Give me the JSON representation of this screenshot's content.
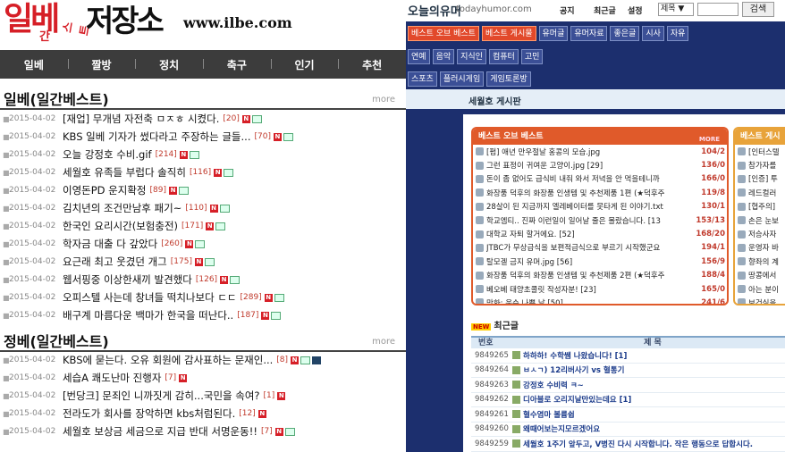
{
  "left": {
    "logo_big": "일베",
    "logo_small": "간",
    "logo_mid": "스트",
    "logo_big2": "저장소",
    "logo_url": "www.ilbe.com",
    "nav": [
      "일베",
      "짤방",
      "정치",
      "축구",
      "인기",
      "추천"
    ],
    "ilbe": {
      "title": "일베(일간베스트)",
      "more": "more",
      "items": [
        {
          "date": "2015-04-02",
          "title": "[재업] 무개념 자전축 ㅁㅈㅎ 시켰다.",
          "count": "[20]",
          "media": [
            "N",
            "img"
          ]
        },
        {
          "date": "2015-04-02",
          "title": "KBS 일베 기자가 썼다라고 주장하는 글들...",
          "count": "[70]",
          "media": [
            "N",
            "img"
          ]
        },
        {
          "date": "2015-04-02",
          "title": "오늘 강정호 수비.gif",
          "count": "[214]",
          "media": [
            "N",
            "img"
          ]
        },
        {
          "date": "2015-04-02",
          "title": "세월호 유족들 부럽다 솔직히",
          "count": "[116]",
          "media": [
            "N",
            "img"
          ]
        },
        {
          "date": "2015-04-02",
          "title": "이영돈PD 운지확정",
          "count": "[89]",
          "media": [
            "N",
            "img"
          ]
        },
        {
          "date": "2015-04-02",
          "title": "김치년의 조건만남후 패기~",
          "count": "[110]",
          "media": [
            "N",
            "img"
          ]
        },
        {
          "date": "2015-04-02",
          "title": "한국인 요리시간(보험충전)",
          "count": "[171]",
          "media": [
            "N",
            "img"
          ]
        },
        {
          "date": "2015-04-02",
          "title": "학자금 대출 다 갚았다",
          "count": "[260]",
          "media": [
            "N",
            "img"
          ]
        },
        {
          "date": "2015-04-02",
          "title": "요근래 최고 웃겼던 개그",
          "count": "[175]",
          "media": [
            "N",
            "img"
          ]
        },
        {
          "date": "2015-04-02",
          "title": "웹서핑중 이상한새끼 발견했다",
          "count": "[126]",
          "media": [
            "N",
            "img"
          ]
        },
        {
          "date": "2015-04-02",
          "title": "오피스텔 사는데 창녀들 떡치나보다 ㄷㄷ",
          "count": "[289]",
          "media": [
            "N",
            "img"
          ]
        },
        {
          "date": "2015-04-02",
          "title": "배구계 마름다운 백마가 한국을 떠난다..",
          "count": "[187]",
          "media": [
            "N",
            "img"
          ]
        }
      ]
    },
    "jungbe": {
      "title": "정베(일간베스트)",
      "more": "more",
      "items": [
        {
          "date": "2015-04-02",
          "title": "KBS에 묻는다. 오유 회원에 감사표하는 문재인...",
          "count": "[8]",
          "media": [
            "N",
            "img",
            "vid"
          ]
        },
        {
          "date": "2015-04-02",
          "title": "세습A 쾌도난마 진행자",
          "count": "[7]",
          "media": [
            "N"
          ]
        },
        {
          "date": "2015-04-02",
          "title": "[번당크] 문죄인 니까짓게 감히...국민을 속여?",
          "count": "[1]",
          "media": [
            "N"
          ]
        },
        {
          "date": "2015-04-02",
          "title": "전라도가 회사를 장악하면 kbs처럼된다.",
          "count": "[12]",
          "media": [
            "N"
          ]
        },
        {
          "date": "2015-04-02",
          "title": "세월호 보상금 세금으로 지급 반대 서명운동!!",
          "count": "[7]",
          "media": [
            "N",
            "img"
          ]
        }
      ]
    }
  },
  "right": {
    "logo": "오늘의유머",
    "logo_sub": "todayhumor.com",
    "top_links": [
      "공지",
      "최근글",
      "설정"
    ],
    "search_select": "제목 ▼",
    "search_button": "검색",
    "tabs_row1": [
      "베스트 오브 베스트",
      "베스트 게시물",
      "유머글",
      "유머자료",
      "좋은글",
      "시사",
      "자유"
    ],
    "tabs_row2": [
      "연예",
      "음악",
      "지식인",
      "컴퓨터",
      "고민"
    ],
    "tabs_row3": [
      "스포츠",
      "플러시게임",
      "게임토론방"
    ],
    "board_title": "세월호 게시판",
    "bob_header": "베스트 오브 베스트",
    "bob_more": "MORE",
    "bob_items": [
      {
        "title": "[펌] 애년 만우절날 홍콩의 모습.jpg",
        "num": "104/2"
      },
      {
        "title": "그런 표정이 귀여운 고양이.jpg [29]",
        "num": "136/0"
      },
      {
        "title": "돈이 좀 없어도 급식비 내줘 와서 저녁을 안 먹을테니까",
        "num": "166/0"
      },
      {
        "title": "화장품 덕후의 화장품 인생템 및 추천제품 1편 (★덕후주",
        "num": "119/8"
      },
      {
        "title": "28살이 된 지금까지 엘레베이터를 못타게 된 이야기.txt",
        "num": "130/1"
      },
      {
        "title": "학교엠티.. 진짜 이런일이 일어날 줄은 몰랐습니다. [13",
        "num": "153/13"
      },
      {
        "title": "대학교 자퇴 할거에요. [52]",
        "num": "168/20"
      },
      {
        "title": "JTBC가 무상급식을 보편적급식으로 부르기 시작했군요",
        "num": "194/1"
      },
      {
        "title": "탈모겔 금지 유머.jpg [56]",
        "num": "156/9"
      },
      {
        "title": "화장품 덕후의 화장품 인생템 및 추천제품 2편 (★덕후주",
        "num": "188/4"
      },
      {
        "title": "베오베 태양초콜릿 작성자분! [23]",
        "num": "165/0"
      },
      {
        "title": "만화: 운수 나쁜 날 [50]",
        "num": "241/6"
      }
    ],
    "side_header": "베스트 게시",
    "side_items": [
      "[인터스텔",
      "참가자를",
      "[인증] 투",
      "레드컬러",
      "[협주의]",
      "손은 눈보",
      "저승사자",
      "운영자 바",
      "향좌의 계",
      "땅콩에서",
      "아는 분이",
      "보건실을"
    ],
    "recent_badge": "NEW",
    "recent_label": "최근글",
    "table_head_no": "번호",
    "table_head_title": "제 목",
    "recent_items": [
      {
        "no": "9849265",
        "title": "하하하! 수학쌤 나왔습니다! [1]"
      },
      {
        "no": "9849264",
        "title": "ㅂㅅㄱ) 12리버사기 vs 혈통기"
      },
      {
        "no": "9849263",
        "title": "강정호 수비력 ㅋ~"
      },
      {
        "no": "9849262",
        "title": "디아블로 오리지날만있는데요 [1]"
      },
      {
        "no": "9849261",
        "title": "혈수염마 볼륨쉽"
      },
      {
        "no": "9849260",
        "title": "왜때어보는지모르겠어요"
      },
      {
        "no": "9849259",
        "title": "세월호 1주기 앞두고, V병진 다시 시작합니다. 작은 행동으로 답합시다."
      }
    ]
  }
}
